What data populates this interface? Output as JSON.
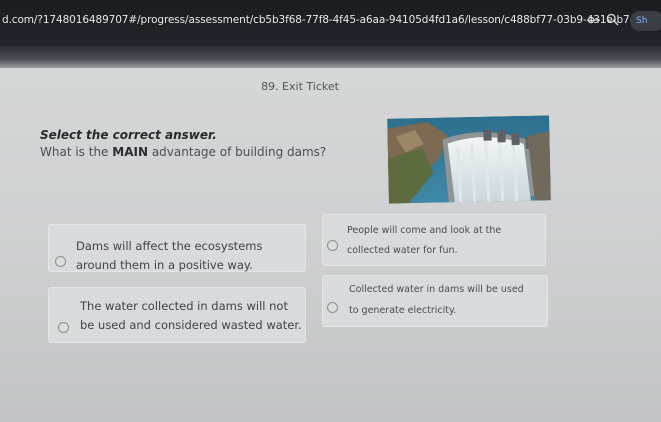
{
  "browser": {
    "url": "d.com/?1748016489707#/progress/assessment/cb5b3f68-77f8-4f45-a6aa-94105d4fd1a6/lesson/c488bf77-03b9-431e-b7e0...",
    "icons": [
      "key-icon",
      "search-icon"
    ],
    "extension_label": "Sh"
  },
  "page": {
    "title": "89. Exit Ticket"
  },
  "question": {
    "instruction": "Select the correct answer.",
    "prefix": "What is the ",
    "emphasis": "MAIN",
    "suffix": " advantage of building dams?"
  },
  "options": [
    {
      "line1": "Dams will affect the ecosystems",
      "line2": "around them in a positive way."
    },
    {
      "line1": "People will come and look at the",
      "line2": "collected water for fun."
    },
    {
      "line1": "The water collected in dams will not",
      "line2": "be used and considered wasted water."
    },
    {
      "line1": "Collected water in dams will be used",
      "line2": "to generate electricity."
    }
  ],
  "colors": {
    "address_bar": "#1a1c20",
    "page_background": "#d0d1d2",
    "text": "#3a3d42",
    "extension_accent": "#8ab4f8"
  }
}
